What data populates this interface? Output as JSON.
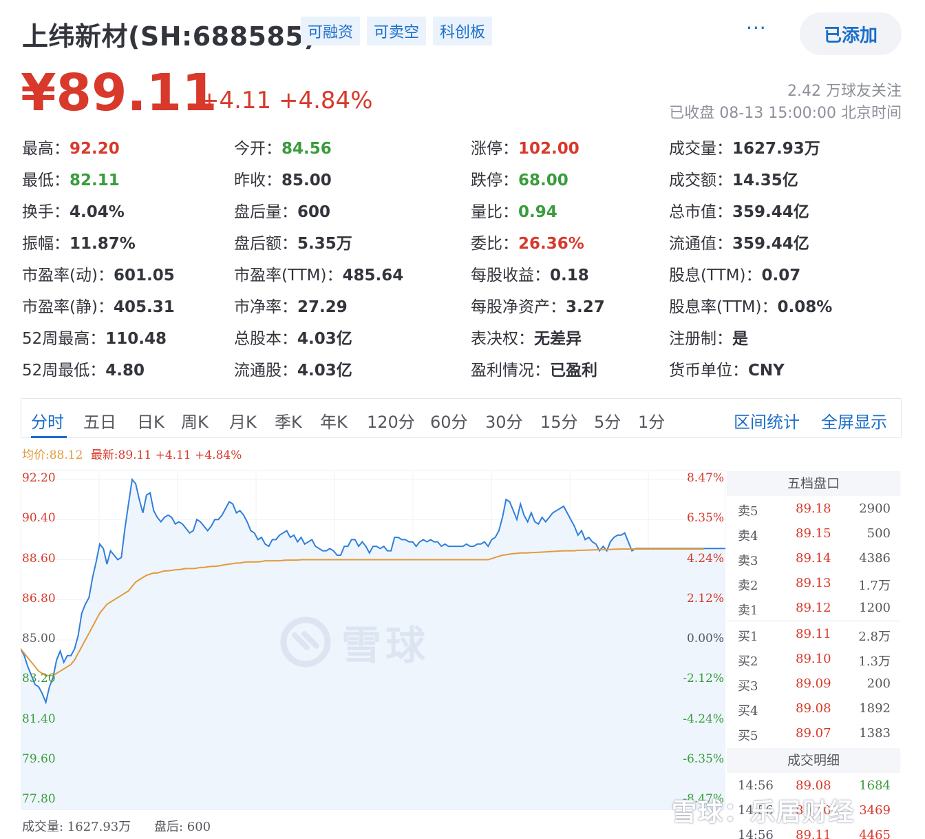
{
  "header": {
    "stock_name": "上纬新材(SH:688585)",
    "tags": [
      "可融资",
      "可卖空",
      "科创板"
    ],
    "more_label": "···",
    "add_button_label": "已添加"
  },
  "price": {
    "current": "¥89.11",
    "change": "+4.11 +4.84%",
    "followers": "2.42 万球友关注",
    "status": "已收盘 08-13 15:00:00 北京时间"
  },
  "quote": [
    [
      {
        "label": "最高：",
        "value": "92.20",
        "color": "red"
      },
      {
        "label": "今开：",
        "value": "84.56",
        "color": "green"
      },
      {
        "label": "涨停：",
        "value": "102.00",
        "color": "red"
      },
      {
        "label": "成交量：",
        "value": "1627.93万",
        "color": ""
      }
    ],
    [
      {
        "label": "最低：",
        "value": "82.11",
        "color": "green"
      },
      {
        "label": "昨收：",
        "value": "85.00",
        "color": ""
      },
      {
        "label": "跌停：",
        "value": "68.00",
        "color": "green"
      },
      {
        "label": "成交额：",
        "value": "14.35亿",
        "color": ""
      }
    ],
    [
      {
        "label": "换手：",
        "value": "4.04%",
        "color": ""
      },
      {
        "label": "盘后量：",
        "value": "600",
        "color": ""
      },
      {
        "label": "量比：",
        "value": "0.94",
        "color": "green"
      },
      {
        "label": "总市值：",
        "value": "359.44亿",
        "color": ""
      }
    ],
    [
      {
        "label": "振幅：",
        "value": "11.87%",
        "color": ""
      },
      {
        "label": "盘后额：",
        "value": "5.35万",
        "color": ""
      },
      {
        "label": "委比：",
        "value": "26.36%",
        "color": "red"
      },
      {
        "label": "流通值：",
        "value": "359.44亿",
        "color": ""
      }
    ],
    [
      {
        "label": "市盈率(动)：",
        "value": "601.05",
        "color": ""
      },
      {
        "label": "市盈率(TTM)：",
        "value": "485.64",
        "color": ""
      },
      {
        "label": "每股收益：",
        "value": "0.18",
        "color": ""
      },
      {
        "label": "股息(TTM)：",
        "value": "0.07",
        "color": ""
      }
    ],
    [
      {
        "label": "市盈率(静)：",
        "value": "405.31",
        "color": ""
      },
      {
        "label": "市净率：",
        "value": "27.29",
        "color": ""
      },
      {
        "label": "每股净资产：",
        "value": "3.27",
        "color": ""
      },
      {
        "label": "股息率(TTM)：",
        "value": "0.08%",
        "color": ""
      }
    ],
    [
      {
        "label": "52周最高：",
        "value": "110.48",
        "color": ""
      },
      {
        "label": "总股本：",
        "value": "4.03亿",
        "color": ""
      },
      {
        "label": "表决权：",
        "value": "无差异",
        "color": ""
      },
      {
        "label": "注册制：",
        "value": "是",
        "color": ""
      }
    ],
    [
      {
        "label": "52周最低：",
        "value": "4.80",
        "color": ""
      },
      {
        "label": "流通股：",
        "value": "4.03亿",
        "color": ""
      },
      {
        "label": "盈利情况：",
        "value": "已盈利",
        "color": ""
      },
      {
        "label": "货币单位：",
        "value": "CNY",
        "color": ""
      }
    ]
  ],
  "tabs": [
    "分时",
    "五日",
    "日K",
    "周K",
    "月K",
    "季K",
    "年K",
    "120分",
    "60分",
    "30分",
    "15分",
    "5分",
    "1分"
  ],
  "tab_actions": [
    "区间统计",
    "全屏显示"
  ],
  "legend": {
    "avg": "均价:88.12",
    "latest": "最新:89.11 +4.11 +4.84%"
  },
  "chart_data": {
    "type": "line",
    "y_ticks_left": [
      "92.20",
      "90.40",
      "88.60",
      "86.80",
      "85.00",
      "83.20",
      "81.40",
      "79.60",
      "77.80"
    ],
    "y_ticks_right": [
      "8.47%",
      "6.35%",
      "4.24%",
      "2.12%",
      "0.00%",
      "-2.12%",
      "-4.24%",
      "-6.35%",
      "-8.47%"
    ],
    "ylim": [
      77.8,
      92.2
    ],
    "prev_close": 85.0,
    "series": [
      {
        "values": [
          84.6,
          84.3,
          83.8,
          83.4,
          83.0,
          82.9,
          82.6,
          82.2,
          82.9,
          83.3,
          84.1,
          84.5,
          84.0,
          84.3,
          84.3,
          84.6,
          85.2,
          86.2,
          86.6,
          86.9,
          87.8,
          88.5,
          89.3,
          89.1,
          88.4,
          89.0,
          88.8,
          88.6,
          88.7,
          90.0,
          91.1,
          92.2,
          92.0,
          91.3,
          90.7,
          91.5,
          91.6,
          90.8,
          90.5,
          90.3,
          90.5,
          90.6,
          90.5,
          90.2,
          90.3,
          90.2,
          90.0,
          89.8,
          89.9,
          90.4,
          90.3,
          90.1,
          89.9,
          90.1,
          90.4,
          90.4,
          90.6,
          90.9,
          91.2,
          91.1,
          90.7,
          90.8,
          90.6,
          90.3,
          89.9,
          89.8,
          89.5,
          89.6,
          89.3,
          89.2,
          89.5,
          89.5,
          89.7,
          89.8,
          89.9,
          89.6,
          89.7,
          89.4,
          89.6,
          89.3,
          89.4,
          89.5,
          89.2,
          89.1,
          89.0,
          89.0,
          89.1,
          89.0,
          88.8,
          88.8,
          89.2,
          89.2,
          89.5,
          89.5,
          89.2,
          89.4,
          89.2,
          88.9,
          89.2,
          89.2,
          89.1,
          89.2,
          89.0,
          89.0,
          89.6,
          89.6,
          89.5,
          89.5,
          89.4,
          89.4,
          89.2,
          89.4,
          89.5,
          89.4,
          89.5,
          89.4,
          89.4,
          89.2,
          89.3,
          89.2,
          89.2,
          89.2,
          89.2,
          89.2,
          89.3,
          89.2,
          89.2,
          89.3,
          89.3,
          89.4,
          89.2,
          89.5,
          89.6,
          89.9,
          90.5,
          91.3,
          91.2,
          90.8,
          90.4,
          91.1,
          90.6,
          90.3,
          90.7,
          90.3,
          90.2,
          90.5,
          90.3,
          90.5,
          90.7,
          90.8,
          90.9,
          91.0,
          90.7,
          90.4,
          90.1,
          89.7,
          89.9,
          89.5,
          89.6,
          89.4,
          89.3,
          89.0,
          89.2,
          89.0,
          89.4,
          89.6,
          89.7,
          89.7,
          89.8,
          89.4,
          89.0,
          89.1,
          89.1,
          89.1,
          89.1,
          89.1,
          89.1,
          89.1,
          89.1,
          89.1,
          89.1,
          89.1,
          89.1,
          89.1,
          89.1,
          89.1,
          89.1,
          89.1,
          89.1,
          89.1,
          89.1,
          89.1,
          89.1,
          89.1,
          89.1,
          89.1,
          89.1
        ]
      },
      {
        "values": [
          84.6,
          84.4,
          84.2,
          84.0,
          83.8,
          83.6,
          83.5,
          83.4,
          83.4,
          83.4,
          83.5,
          83.6,
          83.7,
          83.8,
          83.9,
          84.1,
          84.4,
          84.7,
          85.0,
          85.3,
          85.6,
          85.9,
          86.2,
          86.4,
          86.6,
          86.7,
          86.8,
          86.9,
          87.0,
          87.1,
          87.2,
          87.4,
          87.6,
          87.7,
          87.8,
          87.9,
          87.95,
          88.0,
          88.0,
          88.05,
          88.1,
          88.1,
          88.12,
          88.15,
          88.15,
          88.18,
          88.2,
          88.2,
          88.2,
          88.22,
          88.25,
          88.25,
          88.28,
          88.3,
          88.3,
          88.32,
          88.35,
          88.38,
          88.4,
          88.42,
          88.45,
          88.45,
          88.48,
          88.5,
          88.5,
          88.5,
          88.5,
          88.52,
          88.55,
          88.55,
          88.55,
          88.55,
          88.55,
          88.57,
          88.58,
          88.58,
          88.58,
          88.58,
          88.6,
          88.6,
          88.6,
          88.6,
          88.6,
          88.6,
          88.6,
          88.6,
          88.6,
          88.6,
          88.6,
          88.6,
          88.6,
          88.6,
          88.6,
          88.6,
          88.6,
          88.6,
          88.6,
          88.6,
          88.6,
          88.6,
          88.6,
          88.6,
          88.6,
          88.6,
          88.6,
          88.6,
          88.6,
          88.6,
          88.6,
          88.6,
          88.6,
          88.6,
          88.6,
          88.6,
          88.6,
          88.6,
          88.6,
          88.6,
          88.6,
          88.6,
          88.6,
          88.6,
          88.6,
          88.6,
          88.6,
          88.6,
          88.6,
          88.6,
          88.6,
          88.6,
          88.6,
          88.65,
          88.7,
          88.75,
          88.8,
          88.82,
          88.85,
          88.87,
          88.88,
          88.9,
          88.9,
          88.9,
          88.92,
          88.92,
          88.93,
          88.94,
          88.95,
          88.96,
          88.97,
          88.98,
          88.99,
          89.0,
          89.0,
          89.0,
          89.0,
          89.02,
          89.02,
          89.03,
          89.03,
          89.04,
          89.04,
          89.05,
          89.05,
          89.06,
          89.06,
          89.07,
          89.07,
          89.08,
          89.08,
          89.08,
          89.08,
          89.08,
          89.08,
          89.08,
          89.08,
          89.08,
          89.08,
          89.08,
          89.08,
          89.08,
          89.08,
          89.08,
          89.08,
          89.08,
          89.08,
          89.08,
          89.08,
          89.08,
          89.08,
          89.08,
          89.08
        ]
      }
    ],
    "colors": {
      "price_line": "#2f7fd9",
      "avg_line": "#e39a3b",
      "fill": "#eaf2fc"
    }
  },
  "orderbook": {
    "title": "五档盘口",
    "asks": [
      {
        "label": "卖5",
        "price": "89.18",
        "vol": "2900"
      },
      {
        "label": "卖4",
        "price": "89.15",
        "vol": "500"
      },
      {
        "label": "卖3",
        "price": "89.14",
        "vol": "4386"
      },
      {
        "label": "卖2",
        "price": "89.13",
        "vol": "1.7万"
      },
      {
        "label": "卖1",
        "price": "89.12",
        "vol": "1200"
      }
    ],
    "bids": [
      {
        "label": "买1",
        "price": "89.11",
        "vol": "2.8万"
      },
      {
        "label": "买2",
        "price": "89.10",
        "vol": "1.3万"
      },
      {
        "label": "买3",
        "price": "89.09",
        "vol": "200"
      },
      {
        "label": "买4",
        "price": "89.08",
        "vol": "1892"
      },
      {
        "label": "买5",
        "price": "89.07",
        "vol": "1383"
      }
    ],
    "trades_title": "成交明细",
    "trades": [
      {
        "time": "14:56",
        "price": "89.08",
        "vol": "1684",
        "color": "green"
      },
      {
        "time": "14:56",
        "price": "89.10",
        "vol": "3469",
        "color": "red"
      },
      {
        "time": "14:56",
        "price": "89.11",
        "vol": "4465",
        "color": "red"
      }
    ]
  },
  "bottom": {
    "volume": "成交量: 1627.93万",
    "after_hours": "盘后: 600"
  },
  "watermark": {
    "chart": "雪球",
    "corner": "雪球：乐居财经"
  }
}
